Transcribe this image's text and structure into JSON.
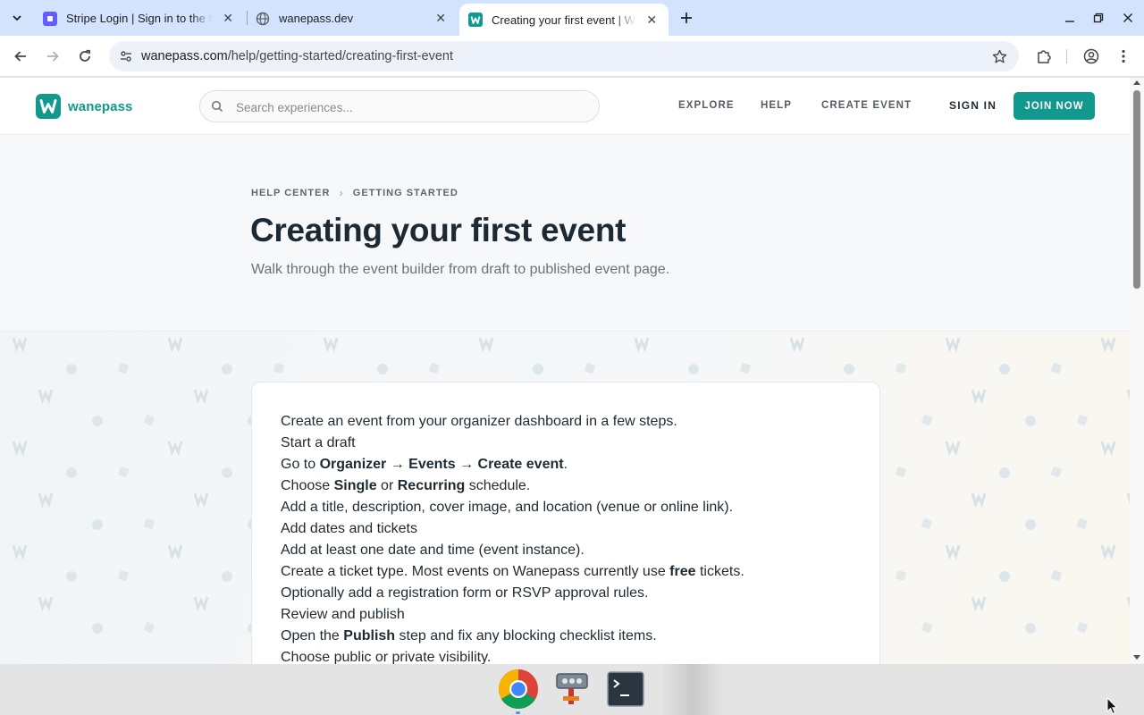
{
  "browser": {
    "tabs": [
      {
        "title": "Stripe Login | Sign in to the Stripe Dashboard",
        "active": false,
        "favicon_color": "#635bff"
      },
      {
        "title": "wanepass.dev",
        "active": false,
        "favicon_color": "#5f6368"
      },
      {
        "title": "Creating your first event | Wanepass",
        "active": true,
        "favicon_color": "#11998e"
      }
    ],
    "url_host": "wanepass.com",
    "url_path": "/help/getting-started/creating-first-event"
  },
  "site": {
    "logo_text": "wanepass",
    "search_placeholder": "Search experiences...",
    "nav": {
      "explore": "EXPLORE",
      "help": "HELP",
      "create_event": "CREATE EVENT",
      "sign_in": "SIGN IN",
      "join_now": "JOIN NOW"
    },
    "brand_color": "#11998e"
  },
  "hero": {
    "breadcrumb": [
      "HELP CENTER",
      "GETTING STARTED"
    ],
    "title": "Creating your first event",
    "subtitle": "Walk through the event builder from draft to published event page."
  },
  "article": {
    "lines": [
      {
        "parts": [
          {
            "t": "Create an event from your organizer dashboard in a few steps."
          }
        ]
      },
      {
        "parts": [
          {
            "t": "Start a draft"
          }
        ]
      },
      {
        "parts": [
          {
            "t": "Go to "
          },
          {
            "t": "Organizer → Events → Create event",
            "b": true
          },
          {
            "t": "."
          }
        ]
      },
      {
        "parts": [
          {
            "t": "Choose "
          },
          {
            "t": "Single",
            "b": true
          },
          {
            "t": " or "
          },
          {
            "t": "Recurring",
            "b": true
          },
          {
            "t": " schedule."
          }
        ]
      },
      {
        "parts": [
          {
            "t": "Add a title, description, cover image, and location (venue or online link)."
          }
        ]
      },
      {
        "parts": [
          {
            "t": "Add dates and tickets"
          }
        ]
      },
      {
        "parts": [
          {
            "t": "Add at least one date and time (event instance)."
          }
        ]
      },
      {
        "parts": [
          {
            "t": "Create a ticket type. Most events on Wanepass currently use "
          },
          {
            "t": "free",
            "b": true
          },
          {
            "t": " tickets."
          }
        ]
      },
      {
        "parts": [
          {
            "t": "Optionally add a registration form or RSVP approval rules."
          }
        ]
      },
      {
        "parts": [
          {
            "t": "Review and publish"
          }
        ]
      },
      {
        "parts": [
          {
            "t": "Open the "
          },
          {
            "t": "Publish",
            "b": true
          },
          {
            "t": " step and fix any blocking checklist items."
          }
        ]
      },
      {
        "parts": [
          {
            "t": "Choose public or private visibility."
          }
        ]
      }
    ]
  },
  "taskbar": {
    "apps": [
      "chrome-icon",
      "network-tool-icon",
      "terminal-icon"
    ]
  }
}
